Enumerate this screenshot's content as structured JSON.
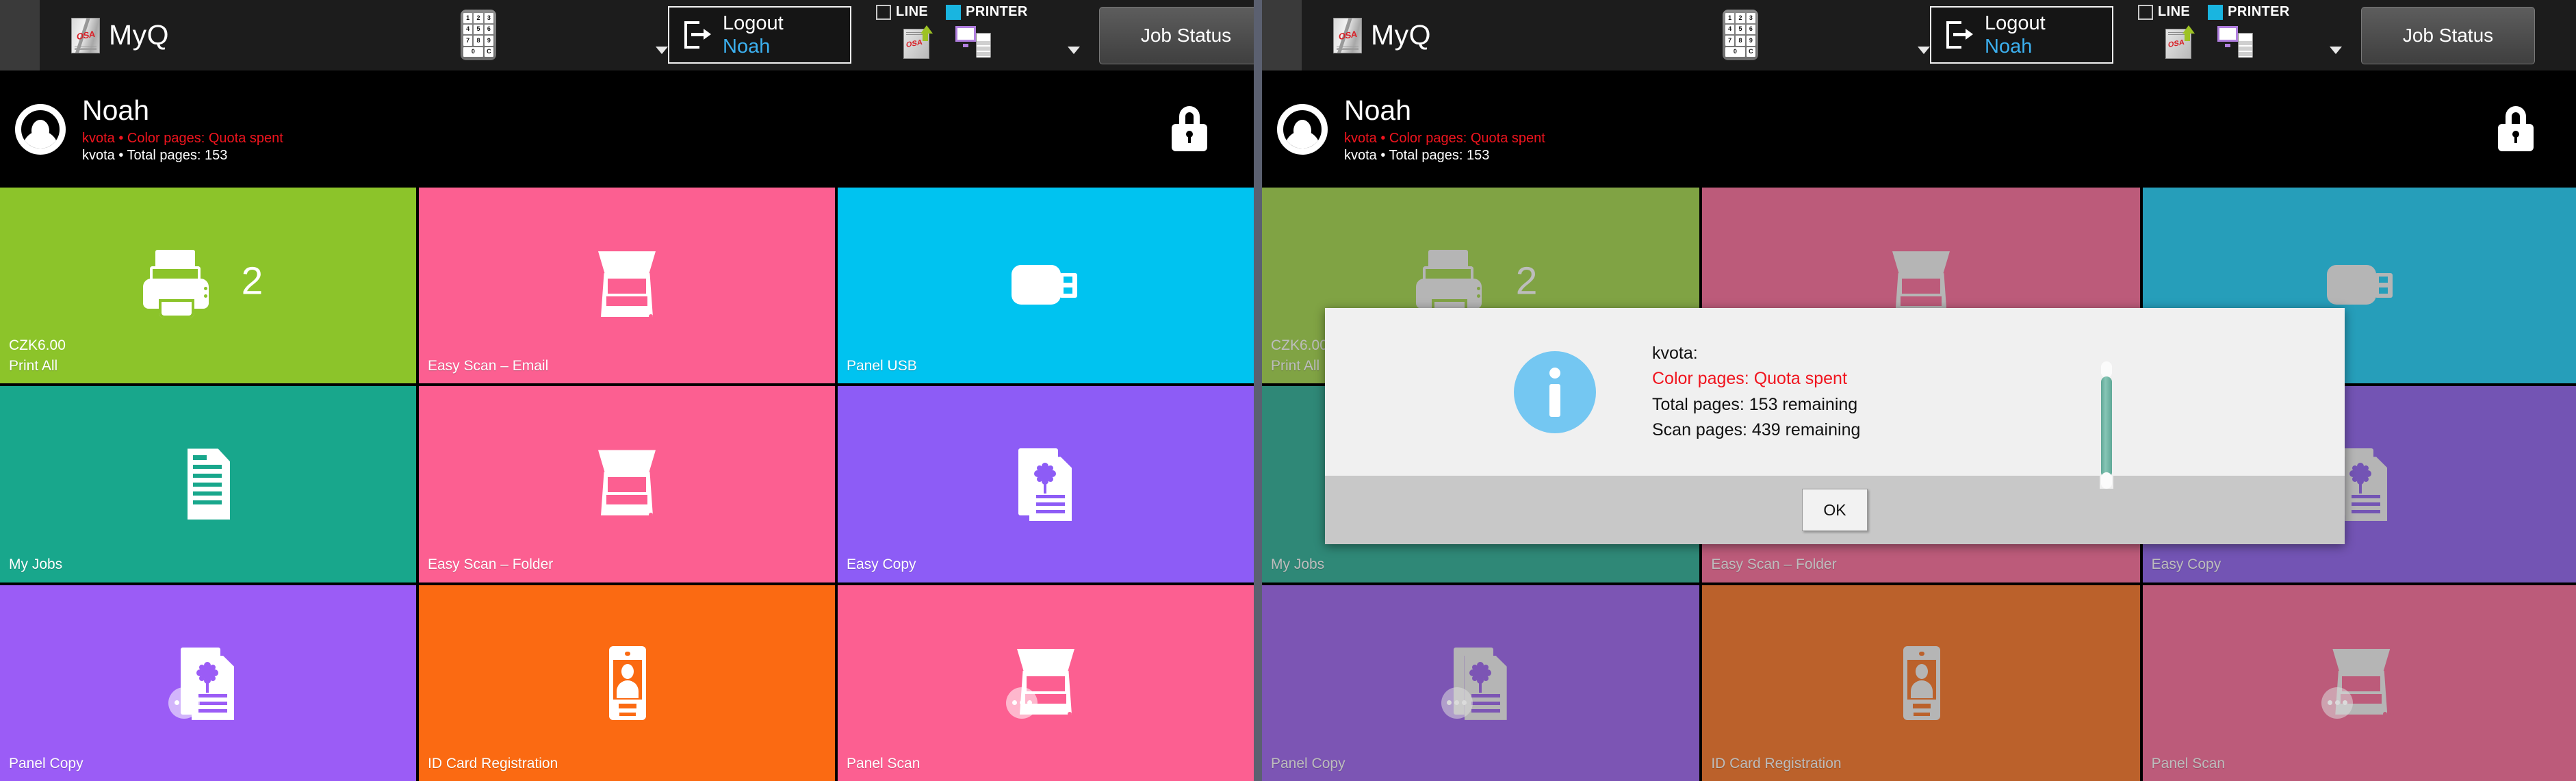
{
  "app": {
    "brand_name": "MyQ",
    "osa_badge_text": "OSA"
  },
  "topbar": {
    "keypad_keys": [
      "1",
      "2",
      "3",
      "4",
      "5",
      "6",
      "7",
      "8",
      "9",
      "0",
      "C"
    ],
    "logout_label": "Logout",
    "logout_user": "Noah",
    "status": [
      {
        "label": "LINE",
        "active": false
      },
      {
        "label": "PRINTER",
        "active": true
      }
    ],
    "job_status_label": "Job Status"
  },
  "user": {
    "name": "Noah",
    "quota_line": "kvota • Color pages: Quota spent",
    "total_line": "kvota • Total pages: 153",
    "quota_color": "#f0141e",
    "lock_icon": "lock-icon"
  },
  "tiles": [
    {
      "label": "Print All",
      "price": "CZK6.00",
      "badge": "2",
      "color": "#8cc42a",
      "icon": "printer-icon"
    },
    {
      "label": "Easy Scan – Email",
      "price": "",
      "badge": "",
      "color": "#fc5f91",
      "icon": "scanner-icon"
    },
    {
      "label": "Panel USB",
      "price": "",
      "badge": "",
      "color": "#00c3f0",
      "icon": "usb-icon"
    },
    {
      "label": "My Jobs",
      "price": "",
      "badge": "",
      "color": "#18a78c",
      "icon": "document-list-icon"
    },
    {
      "label": "Easy Scan – Folder",
      "price": "",
      "badge": "",
      "color": "#fc5f91",
      "icon": "scanner-icon"
    },
    {
      "label": "Easy Copy",
      "price": "",
      "badge": "",
      "color": "#8d5cf6",
      "icon": "copy-icon"
    },
    {
      "label": "Panel Copy",
      "price": "",
      "badge": "",
      "color": "#9b5cf6",
      "icon": "panel-copy-icon"
    },
    {
      "label": "ID Card Registration",
      "price": "",
      "badge": "",
      "color": "#fb6a12",
      "icon": "id-card-icon"
    },
    {
      "label": "Panel Scan",
      "price": "",
      "badge": "",
      "color": "#fc5f91",
      "icon": "panel-scan-icon"
    }
  ],
  "dialog": {
    "title_line": "kvota:",
    "warn_line": "Color pages: Quota spent",
    "total_line": "Total pages: 153 remaining",
    "scan_line": "Scan pages: 439 remaining",
    "ok_label": "OK",
    "info_icon": "info-icon",
    "accent": "#74c7f2",
    "warn_color": "#f0141e",
    "scrollbar_color": "#5fa897"
  }
}
